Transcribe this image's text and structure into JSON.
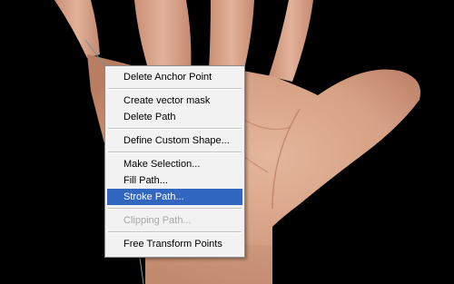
{
  "colors": {
    "background": "#000000",
    "menu_background": "#f2f2f2",
    "menu_highlight": "#3167c0",
    "disabled_text": "#a7a7a7",
    "skin": "#d9a98f"
  },
  "context_menu": {
    "items": [
      {
        "label": "Delete Anchor Point"
      },
      {
        "label": "Create vector mask"
      },
      {
        "label": "Delete Path"
      },
      {
        "label": "Define Custom Shape..."
      },
      {
        "label": "Make Selection..."
      },
      {
        "label": "Fill Path..."
      },
      {
        "label": "Stroke Path...",
        "state": "highlighted"
      },
      {
        "label": "Clipping Path...",
        "state": "disabled"
      },
      {
        "label": "Free Transform Points"
      }
    ]
  }
}
